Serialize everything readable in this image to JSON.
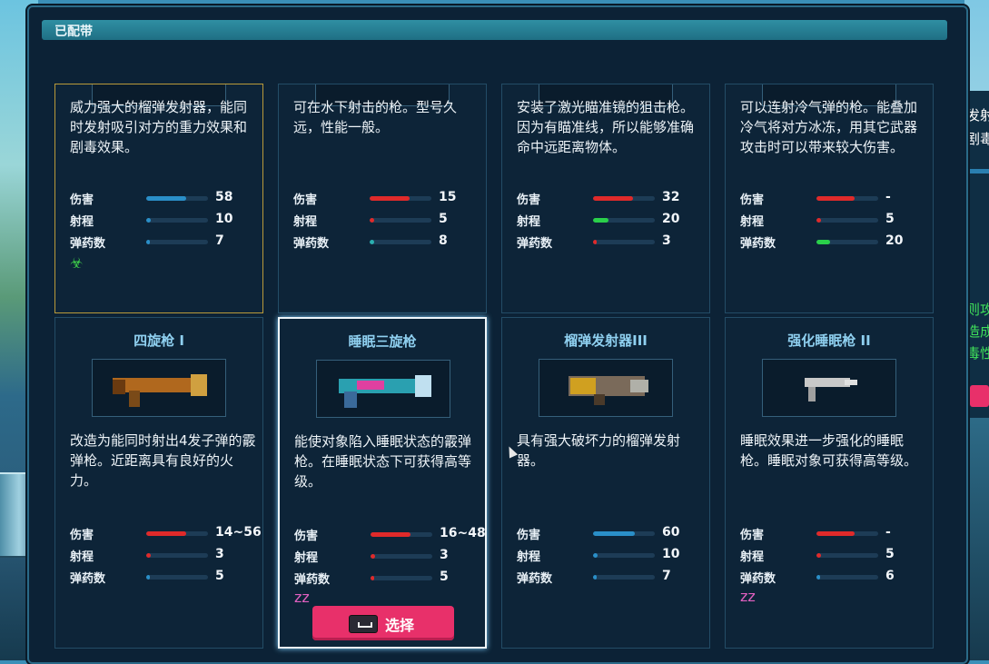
{
  "title": "已配带",
  "select_button": {
    "label": "选择"
  },
  "background_right": {
    "lines": [
      "发射",
      "剧毒"
    ],
    "green_lines": [
      "则攻",
      "造成",
      "毒性"
    ]
  },
  "weapons": [
    {
      "name": "",
      "equipped": true,
      "selected": false,
      "desc": "威力强大的榴弹发射器，能同时发射吸引对方的重力效果和剧毒效果。",
      "stats": [
        {
          "label": "伤害",
          "value": "58",
          "fill": 0.65,
          "color": "#2a8fc8"
        },
        {
          "label": "射程",
          "value": "10",
          "fill": 0.08,
          "color": "#2a8fc8"
        },
        {
          "label": "弹药数",
          "value": "7",
          "fill": 0.06,
          "color": "#2a8fc8"
        }
      ],
      "effect": "biohazard-icon",
      "effect_glyph": "☣",
      "effect_color": "#3fd04a",
      "image": "gravity-grenade-launcher"
    },
    {
      "name": "",
      "equipped": false,
      "selected": false,
      "desc": "可在水下射击的枪。型号久远，性能一般。",
      "stats": [
        {
          "label": "伤害",
          "value": "15",
          "fill": 0.65,
          "color": "#e02a2a"
        },
        {
          "label": "射程",
          "value": "5",
          "fill": 0.08,
          "color": "#e02a2a"
        },
        {
          "label": "弹药数",
          "value": "8",
          "fill": 0.08,
          "color": "#2ab0b0"
        }
      ],
      "effect": "",
      "effect_glyph": "",
      "effect_color": "",
      "image": "underwater-gun"
    },
    {
      "name": "",
      "equipped": false,
      "selected": false,
      "desc": "安装了激光瞄准镜的狙击枪。因为有瞄准线，所以能够准确命中远距离物体。",
      "stats": [
        {
          "label": "伤害",
          "value": "32",
          "fill": 0.65,
          "color": "#e02a2a"
        },
        {
          "label": "射程",
          "value": "20",
          "fill": 0.25,
          "color": "#2ad04a"
        },
        {
          "label": "弹药数",
          "value": "3",
          "fill": 0.06,
          "color": "#e02a2a"
        }
      ],
      "effect": "",
      "effect_glyph": "",
      "effect_color": "",
      "image": "laser-sniper-rifle"
    },
    {
      "name": "",
      "equipped": false,
      "selected": false,
      "desc": "可以连射冷气弹的枪。能叠加冷气将对方冰冻，用其它武器攻击时可以带来较大伤害。",
      "stats": [
        {
          "label": "伤害",
          "value": "-",
          "fill": 0.62,
          "color": "#e02a2a"
        },
        {
          "label": "射程",
          "value": "5",
          "fill": 0.08,
          "color": "#e02a2a"
        },
        {
          "label": "弹药数",
          "value": "20",
          "fill": 0.22,
          "color": "#2ad04a"
        }
      ],
      "effect": "",
      "effect_glyph": "",
      "effect_color": "",
      "image": "freeze-gun"
    },
    {
      "name": "四旋枪 I",
      "equipped": false,
      "selected": false,
      "desc": "改造为能同时射出4发子弹的霰弹枪。近距离具有良好的火力。",
      "stats": [
        {
          "label": "伤害",
          "value": "14~56",
          "fill": 0.65,
          "color": "#e02a2a"
        },
        {
          "label": "射程",
          "value": "3",
          "fill": 0.08,
          "color": "#e02a2a"
        },
        {
          "label": "弹药数",
          "value": "5",
          "fill": 0.06,
          "color": "#2a8fc8"
        }
      ],
      "effect": "",
      "effect_glyph": "",
      "effect_color": "",
      "image": "quad-shotgun"
    },
    {
      "name": "睡眠三旋枪",
      "equipped": false,
      "selected": true,
      "desc": "能使对象陷入睡眠状态的霰弹枪。在睡眠状态下可获得高等级。",
      "stats": [
        {
          "label": "伤害",
          "value": "16~48",
          "fill": 0.65,
          "color": "#e02a2a"
        },
        {
          "label": "射程",
          "value": "3",
          "fill": 0.08,
          "color": "#e02a2a"
        },
        {
          "label": "弹药数",
          "value": "5",
          "fill": 0.06,
          "color": "#e02a2a"
        }
      ],
      "effect": "sleep-icon",
      "effect_glyph": "zz",
      "effect_color": "#e060c0",
      "image": "sleep-triple-shotgun"
    },
    {
      "name": "榴弹发射器III",
      "equipped": false,
      "selected": false,
      "desc": "具有强大破坏力的榴弹发射器。",
      "stats": [
        {
          "label": "伤害",
          "value": "60",
          "fill": 0.68,
          "color": "#2a8fc8"
        },
        {
          "label": "射程",
          "value": "10",
          "fill": 0.08,
          "color": "#2a8fc8"
        },
        {
          "label": "弹药数",
          "value": "7",
          "fill": 0.06,
          "color": "#2a8fc8"
        }
      ],
      "effect": "",
      "effect_glyph": "",
      "effect_color": "",
      "image": "grenade-launcher-iii"
    },
    {
      "name": "强化睡眠枪 II",
      "equipped": false,
      "selected": false,
      "desc": "睡眠效果进一步强化的睡眠枪。睡眠对象可获得高等级。",
      "stats": [
        {
          "label": "伤害",
          "value": "-",
          "fill": 0.62,
          "color": "#e02a2a"
        },
        {
          "label": "射程",
          "value": "5",
          "fill": 0.08,
          "color": "#e02a2a"
        },
        {
          "label": "弹药数",
          "value": "6",
          "fill": 0.06,
          "color": "#2a8fc8"
        }
      ],
      "effect": "sleep-icon",
      "effect_glyph": "zz",
      "effect_color": "#e060c0",
      "image": "enhanced-sleep-gun-ii"
    }
  ]
}
